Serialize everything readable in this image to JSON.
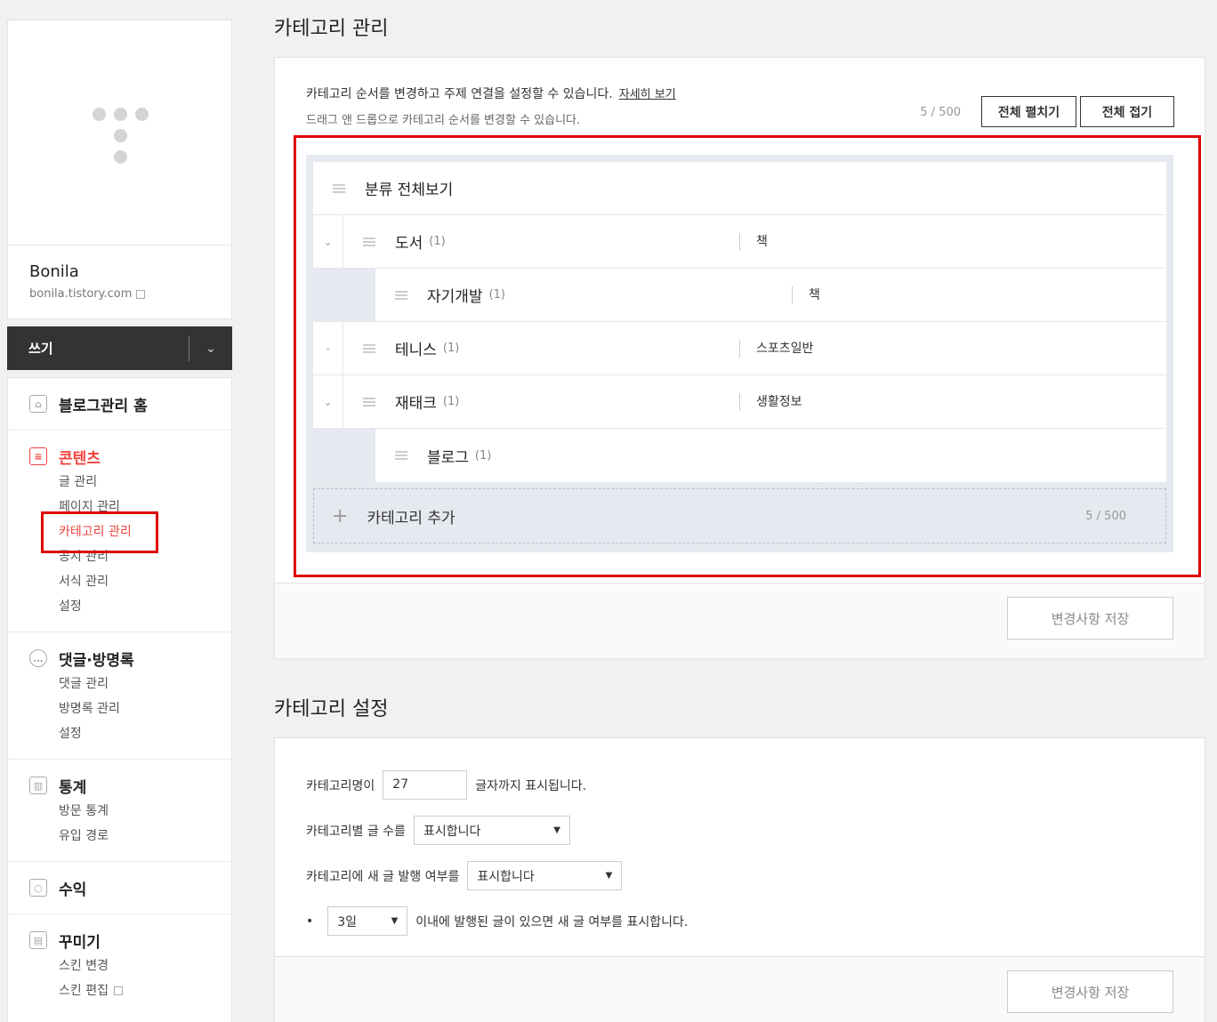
{
  "sidebar": {
    "blog_name": "Bonila",
    "blog_url": "bonila.tistory.com",
    "write_label": "쓰기",
    "groups": [
      {
        "title": "블로그관리 홈",
        "icon": "home-icon",
        "items": []
      },
      {
        "title": "콘텐츠",
        "icon": "document-icon",
        "active": true,
        "items": [
          "글 관리",
          "페이지 관리",
          "카테고리 관리",
          "공지 관리",
          "서식 관리",
          "설정"
        ]
      },
      {
        "title": "댓글·방명록",
        "icon": "comment-icon",
        "items": [
          "댓글 관리",
          "방명록 관리",
          "설정"
        ]
      },
      {
        "title": "통계",
        "icon": "chart-icon",
        "items": [
          "방문 통계",
          "유입 경로"
        ]
      },
      {
        "title": "수익",
        "icon": "coins-icon",
        "items": []
      },
      {
        "title": "꾸미기",
        "icon": "layout-icon",
        "items": [
          "스킨 변경",
          "스킨 편집"
        ]
      }
    ]
  },
  "category_manage": {
    "title": "카테고리 관리",
    "desc_line1": "카테고리 순서를 변경하고 주제 연결을 설정할 수 있습니다.",
    "detail_link": "자세히 보기",
    "desc_line2": "드래그 앤 드롭으로 카테고리 순서를 변경할 수 있습니다.",
    "counter": "5 / 500",
    "expand_all": "전체 펼치기",
    "collapse_all": "전체 접기",
    "all_view": "분류 전체보기",
    "categories": [
      {
        "name": "도서",
        "count": "(1)",
        "topic": "책",
        "toggle": "⌄"
      },
      {
        "name": "자기개발",
        "count": "(1)",
        "topic": "책",
        "child": true
      },
      {
        "name": "테니스",
        "count": "(1)",
        "topic": "스포츠일반",
        "toggle": "-"
      },
      {
        "name": "재태크",
        "count": "(1)",
        "topic": "생활정보",
        "toggle": "⌄"
      },
      {
        "name": "블로그",
        "count": "(1)",
        "topic": "",
        "child": true
      }
    ],
    "add_label": "카테고리 추가",
    "add_counter": "5 / 500",
    "save_label": "변경사항 저장"
  },
  "category_settings": {
    "title": "카테고리 설정",
    "name_len_label": "카테고리명이",
    "name_len_value": "27",
    "name_len_suffix": "글자까지 표시됩니다.",
    "post_count_label": "카테고리별 글 수를",
    "post_count_value": "표시합니다",
    "new_post_label": "카테고리에 새 글 발행 여부를",
    "new_post_value": "표시합니다",
    "bullet": "•",
    "days_value": "3일",
    "days_suffix": "이내에 발행된 글이 있으면 새 글 여부를 표시합니다.",
    "save_label": "변경사항 저장"
  },
  "colors": {
    "accent": "#f0443e",
    "highlight_box": "#e00000",
    "write_bar": "#333333"
  }
}
